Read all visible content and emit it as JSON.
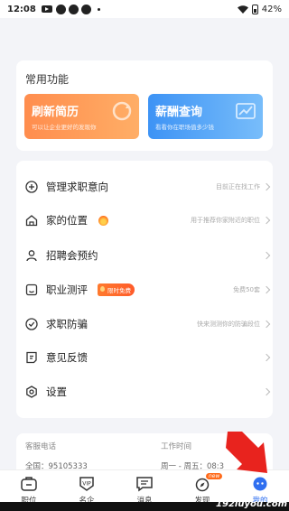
{
  "status_bar": {
    "time": "12:08",
    "battery": "42%"
  },
  "features": {
    "title": "常用功能",
    "tiles": [
      {
        "title": "刷新简历",
        "subtitle": "可以让企业更好的发现你",
        "color": "#ff9a55"
      },
      {
        "title": "薪酬查询",
        "subtitle": "看看你在职场值多少钱",
        "color": "#4a9cf6"
      }
    ]
  },
  "menu": [
    {
      "label": "管理求职意向",
      "hint": "目前正在找工作",
      "icon": "plus-circle-icon"
    },
    {
      "label": "家的位置",
      "hint": "用于推荐你家附近的职位",
      "icon": "home-icon"
    },
    {
      "label": "招聘会预约",
      "hint": "",
      "icon": "person-icon"
    },
    {
      "label": "职业测评",
      "hint": "免费50套",
      "badge": "限时免费",
      "icon": "assessment-icon"
    },
    {
      "label": "求职防骗",
      "hint": "快来测测你的防骗段位",
      "icon": "shield-check-icon"
    },
    {
      "label": "意见反馈",
      "hint": "",
      "icon": "feedback-icon"
    },
    {
      "label": "设置",
      "hint": "",
      "icon": "settings-icon"
    }
  ],
  "contact": {
    "phone_label": "客服电话",
    "phone_value": "全国：95105333",
    "hours_label": "工作时间",
    "hours_value": "周一 - 周五：08:3"
  },
  "tabs": [
    {
      "label": "职位",
      "icon": "briefcase-icon"
    },
    {
      "label": "名企",
      "icon": "vip-company-icon"
    },
    {
      "label": "消息",
      "icon": "message-icon"
    },
    {
      "label": "发现",
      "icon": "discover-icon",
      "badge": "new"
    },
    {
      "label": "我的",
      "icon": "profile-icon",
      "active": true
    }
  ],
  "watermark": "192luyou.com",
  "colors": {
    "accent": "#2f6ff0",
    "orange": "#ff8d4e",
    "blue": "#3d93f5",
    "arrow": "#e8231e"
  }
}
